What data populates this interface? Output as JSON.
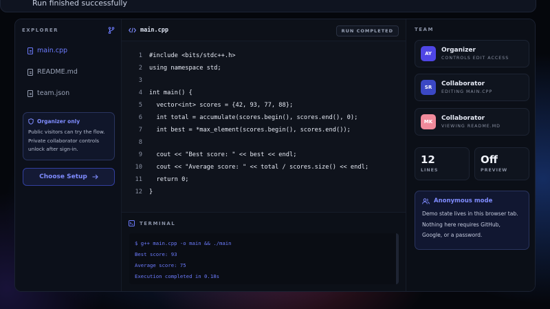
{
  "toast": {
    "text": "Run finished successfully"
  },
  "explorer": {
    "title": "EXPLORER",
    "files": [
      {
        "name": "main.cpp",
        "active": true
      },
      {
        "name": "README.md",
        "active": false
      },
      {
        "name": "team.json",
        "active": false
      }
    ],
    "notice": {
      "title": "Organizer only",
      "text": "Public visitors can try the flow. Private collaborator controls unlock after sign-in."
    },
    "setup_button": "Choose Setup"
  },
  "editor": {
    "filename": "main.cpp",
    "status_badge": "RUN COMPLETED",
    "code_lines": [
      "#include <bits/stdc++.h>",
      "using namespace std;",
      "",
      "int main() {",
      "  vector<int> scores = {42, 93, 77, 88};",
      "  int total = accumulate(scores.begin(), scores.end(), 0);",
      "  int best = *max_element(scores.begin(), scores.end());",
      "",
      "  cout << \"Best score: \" << best << endl;",
      "  cout << \"Average score: \" << total / scores.size() << endl;",
      "  return 0;",
      "}"
    ]
  },
  "terminal": {
    "title": "TERMINAL",
    "lines": [
      "$ g++ main.cpp -o main && ./main",
      "Best score: 93",
      "Average score: 75",
      "Execution completed in 0.18s"
    ]
  },
  "team": {
    "title": "TEAM",
    "members": [
      {
        "initials": "AY",
        "name": "Organizer",
        "role": "CONTROLS EDIT ACCESS",
        "color": "#4f46e5"
      },
      {
        "initials": "SR",
        "name": "Collaborator",
        "role": "EDITING MAIN.CPP",
        "color": "#3b48c4"
      },
      {
        "initials": "MK",
        "name": "Collaborator",
        "role": "VIEWING README.MD",
        "color": "#f08a9b"
      }
    ],
    "stats": [
      {
        "value": "12",
        "label": "LINES"
      },
      {
        "value": "Off",
        "label": "PREVIEW"
      }
    ],
    "anon": {
      "title": "Anonymous mode",
      "text": "Demo state lives in this browser tab. Nothing here requires GitHub, Google, or a password."
    }
  }
}
